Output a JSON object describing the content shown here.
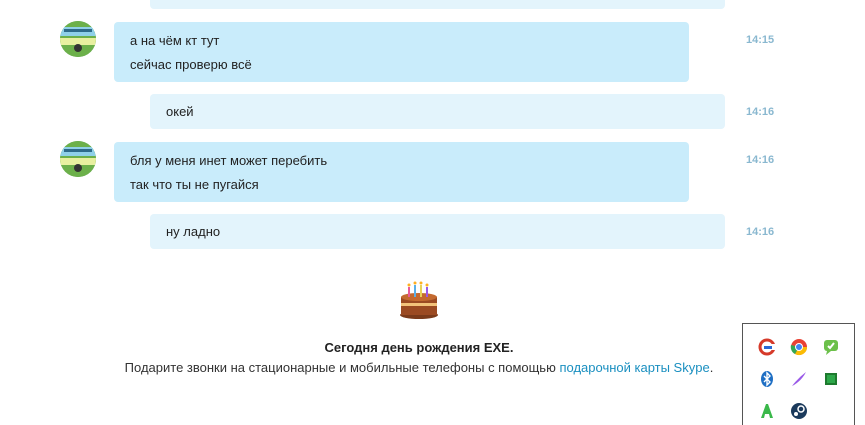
{
  "messages": [
    {
      "sender": "them",
      "lines": [
        "а на чём кт тут",
        "сейчас проверю всё"
      ],
      "time": "14:15"
    },
    {
      "sender": "me",
      "lines": [
        "окей"
      ],
      "time": "14:16"
    },
    {
      "sender": "them",
      "lines": [
        "бля у меня инет может перебить",
        "так что ты не пугайся"
      ],
      "time": "14:16"
    },
    {
      "sender": "me",
      "lines": [
        "ну ладно"
      ],
      "time": "14:16"
    }
  ],
  "birthday": {
    "title": "Сегодня день рождения EXE.",
    "text": "Подарите звонки на стационарные и мобильные телефоны с помощью",
    "link": "подарочной карты Skype",
    "suffix": "."
  },
  "tray": {
    "icons": [
      "ccleaner-icon",
      "chrome-icon",
      "chat-icon",
      "bluetooth-icon",
      "feather-icon",
      "green-square-icon",
      "text-icon",
      "steam-icon"
    ]
  },
  "colors": {
    "them_bubble": "#c9ecfb",
    "me_bubble": "#e3f4fc",
    "time": "#8ab8d0",
    "link": "#1a8fc0"
  }
}
